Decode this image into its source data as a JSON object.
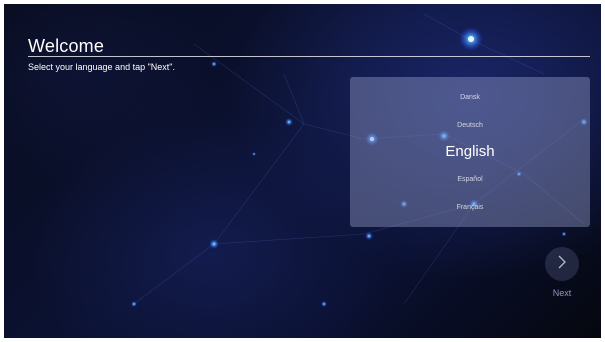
{
  "header": {
    "title": "Welcome",
    "subtitle": "Select your language and tap \"Next\"."
  },
  "language_list": {
    "items": [
      {
        "label": "Dansk",
        "selected": false
      },
      {
        "label": "Deutsch",
        "selected": false
      },
      {
        "label": "English",
        "selected": true
      },
      {
        "label": "Español",
        "selected": false
      },
      {
        "label": "Français",
        "selected": false
      }
    ]
  },
  "next": {
    "label": "Next",
    "icon": "chevron-right-icon"
  },
  "colors": {
    "background": "#0b1233",
    "panel": "#9aa0c8",
    "text": "#ffffff",
    "accent": "#4aa8ff"
  }
}
